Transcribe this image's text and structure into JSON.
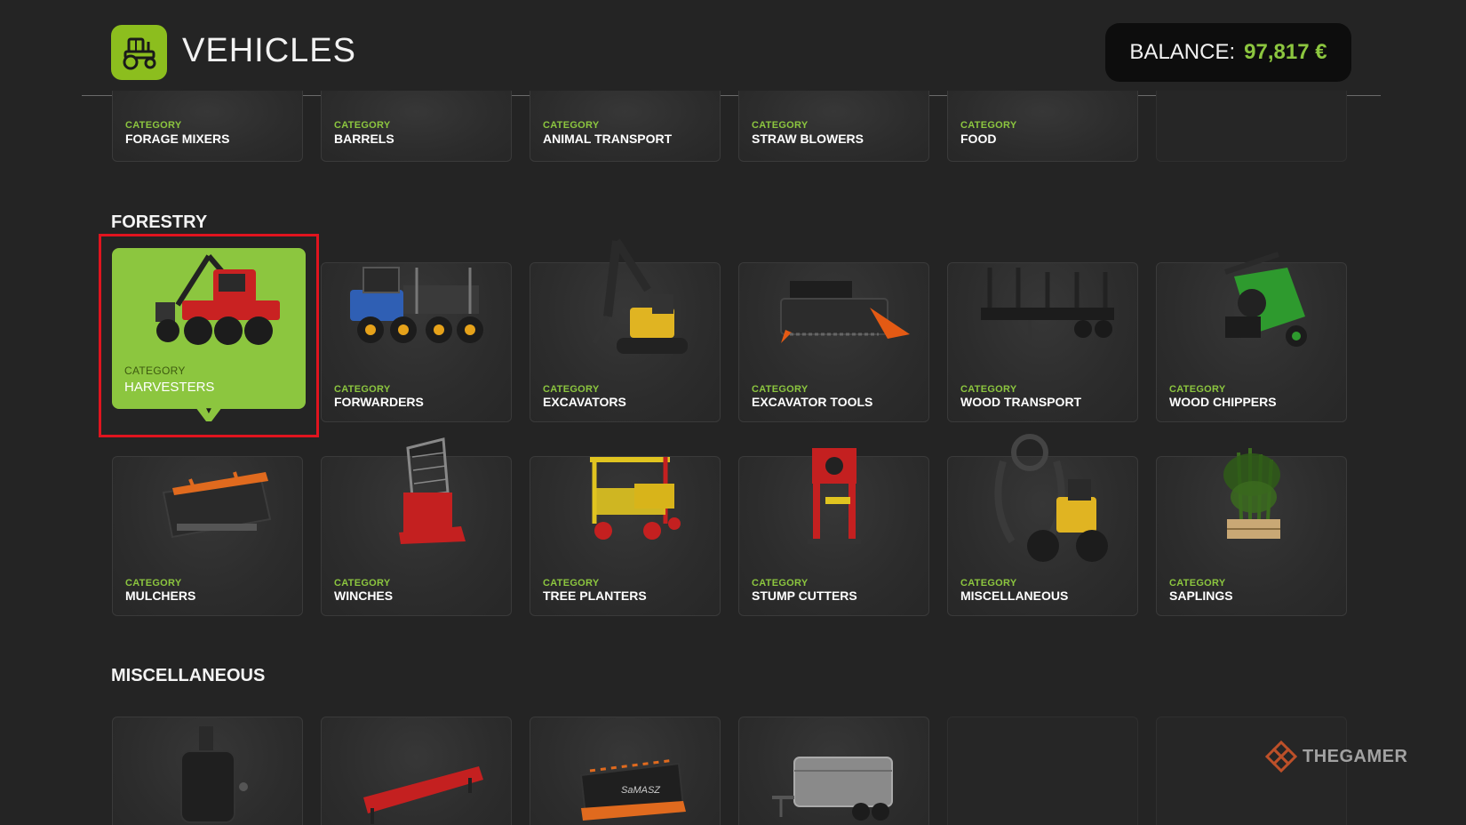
{
  "header": {
    "title": "VEHICLES",
    "icon": "tractor-icon",
    "balance_label": "BALANCE:",
    "balance_value": "97,817 €"
  },
  "colors": {
    "accent": "#8cc63f",
    "selection_outline": "#e0141e",
    "background": "#242424"
  },
  "top_row": [
    {
      "label": "CATEGORY",
      "name": "FORAGE MIXERS"
    },
    {
      "label": "CATEGORY",
      "name": "BARRELS"
    },
    {
      "label": "CATEGORY",
      "name": "ANIMAL TRANSPORT"
    },
    {
      "label": "CATEGORY",
      "name": "STRAW BLOWERS"
    },
    {
      "label": "CATEGORY",
      "name": "FOOD"
    }
  ],
  "sections": {
    "forestry": {
      "title": "FORESTRY",
      "row1": [
        {
          "label": "CATEGORY",
          "name": "HARVESTERS",
          "icon": "harvester-icon",
          "selected": true
        },
        {
          "label": "CATEGORY",
          "name": "FORWARDERS",
          "icon": "forwarder-icon"
        },
        {
          "label": "CATEGORY",
          "name": "EXCAVATORS",
          "icon": "excavator-icon"
        },
        {
          "label": "CATEGORY",
          "name": "EXCAVATOR TOOLS",
          "icon": "excavator-tool-icon"
        },
        {
          "label": "CATEGORY",
          "name": "WOOD TRANSPORT",
          "icon": "wood-trailer-icon"
        },
        {
          "label": "CATEGORY",
          "name": "WOOD CHIPPERS",
          "icon": "wood-chipper-icon"
        }
      ],
      "row2": [
        {
          "label": "CATEGORY",
          "name": "MULCHERS",
          "icon": "mulcher-icon"
        },
        {
          "label": "CATEGORY",
          "name": "WINCHES",
          "icon": "winch-icon"
        },
        {
          "label": "CATEGORY",
          "name": "TREE PLANTERS",
          "icon": "tree-planter-icon"
        },
        {
          "label": "CATEGORY",
          "name": "STUMP CUTTERS",
          "icon": "stump-cutter-icon"
        },
        {
          "label": "CATEGORY",
          "name": "MISCELLANEOUS",
          "icon": "grapple-loader-icon"
        },
        {
          "label": "CATEGORY",
          "name": "SAPLINGS",
          "icon": "saplings-icon"
        }
      ]
    },
    "miscellaneous": {
      "title": "MISCELLANEOUS",
      "row1": [
        {
          "icon": "weight-icon"
        },
        {
          "icon": "red-implement-icon"
        },
        {
          "icon": "snow-plow-icon",
          "brand": "SaMASZ"
        },
        {
          "icon": "cargo-trailer-icon"
        }
      ]
    }
  },
  "watermark": {
    "text": "THEGAMER",
    "icon": "thegamer-logo-icon"
  }
}
